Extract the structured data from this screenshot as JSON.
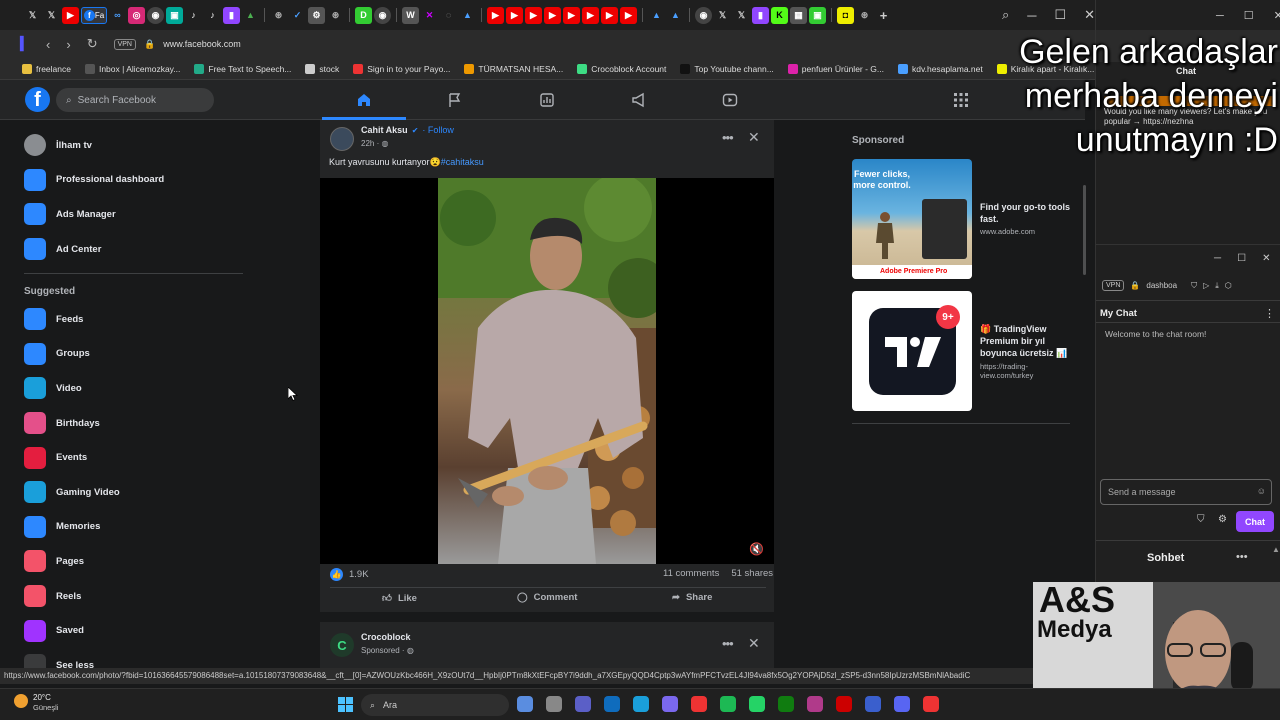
{
  "browser": {
    "url": "www.facebook.com",
    "vpn_badge": "VPN",
    "active_tab_label": "Fa",
    "bookmarks": [
      "freelance",
      "Inbox | Alicemozkay...",
      "Free Text to Speech...",
      "stock",
      "Sign in to your Payo...",
      "TÜRMATSAN HESA...",
      "Crocoblock Account",
      "Top Youtube chann...",
      "penfuen Ürünler - G...",
      "kdv.hesaplama.net",
      "Kiralık apart - Kiralık..."
    ],
    "status_url": "https://www.facebook.com/photo/?fbid=101636645579086488set=a.10151807379083648&__cft__[0]=AZWOUzKbc466H_X9zOUt7d__HpbIj0PTm8kXtEFcpBY7i9ddh_a7XGEpyQQD4Cptp3wAYfmPFCTvzEL4JI94va8fx5Og2YOPAjD5zl_zSP5-d3nn58IpUzrzMSBmNlAbadiC"
  },
  "facebook": {
    "logo": "f",
    "search_placeholder": "Search Facebook",
    "sidebar": {
      "items": [
        {
          "label": "İlham tv",
          "icon": "avatar",
          "color": "#8a8d91"
        },
        {
          "label": "Professional dashboard",
          "icon": "dashboard-icon",
          "color": "#2d88ff"
        },
        {
          "label": "Ads Manager",
          "icon": "ads-manager-icon",
          "color": "#2d88ff"
        },
        {
          "label": "Ad Center",
          "icon": "megaphone-icon",
          "color": "#2d88ff"
        }
      ],
      "suggested_heading": "Suggested",
      "suggested": [
        {
          "label": "Feeds",
          "icon": "feeds-icon",
          "color": "#2d88ff"
        },
        {
          "label": "Groups",
          "icon": "groups-icon",
          "color": "#2d88ff"
        },
        {
          "label": "Video",
          "icon": "video-icon",
          "color": "#1a9fda"
        },
        {
          "label": "Birthdays",
          "icon": "gift-icon",
          "color": "#e4508a"
        },
        {
          "label": "Events",
          "icon": "calendar-icon",
          "color": "#e41e3f"
        },
        {
          "label": "Gaming Video",
          "icon": "gaming-icon",
          "color": "#1a9fda"
        },
        {
          "label": "Memories",
          "icon": "clock-icon",
          "color": "#2d88ff"
        },
        {
          "label": "Pages",
          "icon": "flag-icon",
          "color": "#f35369"
        },
        {
          "label": "Reels",
          "icon": "reels-icon",
          "color": "#f35369"
        },
        {
          "label": "Saved",
          "icon": "bookmark-icon",
          "color": "#a033ff"
        },
        {
          "label": "See less",
          "icon": "chevron-up-icon",
          "color": "#3a3b3c"
        }
      ]
    },
    "post": {
      "author": "Cahit Aksu",
      "follow": "Follow",
      "time": "22h · ",
      "caption": "Kurt yavrusunu kurtanyor😧",
      "hashtag": "#cahitaksu",
      "reactions": "1.9K",
      "comments": "11 comments",
      "shares": "51 shares",
      "like_label": "Like",
      "comment_label": "Comment",
      "share_label": "Share"
    },
    "post2": {
      "author": "Crocoblock",
      "meta": "Sponsored · "
    },
    "sponsored": {
      "heading": "Sponsored",
      "ads": [
        {
          "image_text": "Fewer clicks, more control.",
          "brand": "Adobe Premiere Pro",
          "title": "Find your go-to tools fast.",
          "domain": "www.adobe.com"
        },
        {
          "badge": "9+",
          "title": "🎁 TradingView Premium bir yıl boyunca ücretsiz 📊",
          "domain": "https://trading-view.com/turkey"
        }
      ]
    }
  },
  "overlay_text": "Gelen arkadaşlar merhaba demeyi unutmayın :D",
  "chat": {
    "top_title": "Chat",
    "top_msg": "Would you like many viewers? Let's make you popular → https://nezhna",
    "mini_url": "dashboa",
    "vpn_badge": "VPN",
    "my_chat": "My Chat",
    "welcome": "Welcome to the chat room!",
    "input_placeholder": "Send a message",
    "chat_button": "Chat",
    "footer_title": "Sohbet"
  },
  "webcam_logo_line1": "A&S",
  "webcam_logo_line2": "Medya",
  "taskbar": {
    "temp": "20°C",
    "weather": "Güneşli",
    "search": "Ara"
  }
}
